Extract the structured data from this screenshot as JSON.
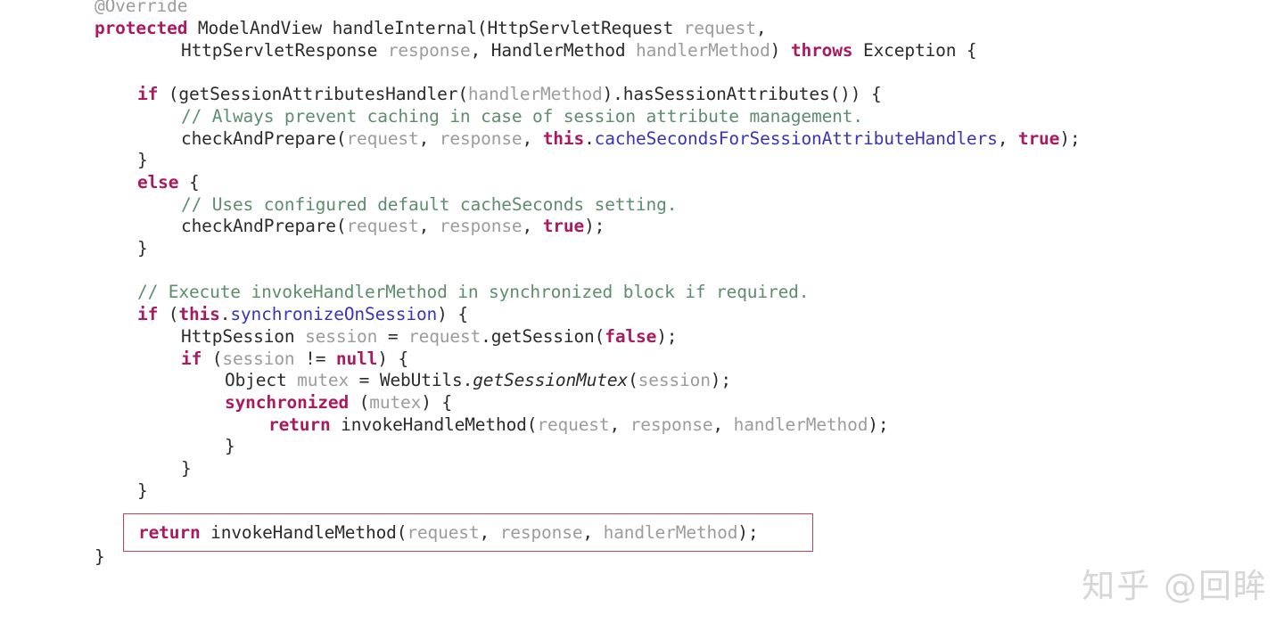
{
  "editor": {
    "language": "java",
    "background_color": "#ffffff",
    "font_size_px": 19.5,
    "line_height_px": 24.7,
    "colors": {
      "keyword": "#a91b60",
      "type": "#2b2b2b",
      "identifier": "#2b2b2b",
      "parameter": "#9c9c9c",
      "field": "#3a35b8",
      "comment": "#5d8d6e",
      "annotation": "#9c9c9c",
      "static_method": "#2b2b2b",
      "highlight_border": "#c0405c",
      "watermark": "#d6d6d6"
    }
  },
  "code": {
    "line_01": {
      "annotation": "@Override"
    },
    "line_02": {
      "kw_protected": "protected",
      "type_modelandview": "ModelAndView",
      "method_handleinternal": "handleInternal",
      "paren_open": "(",
      "type_httpservletrequest": "HttpServletRequest",
      "param_request": "request",
      "comma": ","
    },
    "line_03": {
      "type_httpservletresponse": "HttpServletResponse",
      "param_response": "response",
      "comma": ", ",
      "type_handlermethod": "HandlerMethod",
      "param_handlermethod": "handlerMethod",
      "paren_close": ")",
      "kw_throws": "throws",
      "type_exception": "Exception",
      "brace_open": "{"
    },
    "line_05": {
      "kw_if": "if",
      "open": " (",
      "method_getsessionattributeshandler": "getSessionAttributesHandler",
      "paren_open": "(",
      "param_handlermethod": "handlerMethod",
      "dot": ").",
      "method_hassessionattributes": "hasSessionAttributes",
      "tail": "()) {"
    },
    "line_06": {
      "comment": "// Always prevent caching in case of session attribute management."
    },
    "line_07": {
      "method_checkandprepare": "checkAndPrepare",
      "paren_open": "(",
      "param_request": "request",
      "comma1": ", ",
      "param_response": "response",
      "comma2": ", ",
      "kw_this": "this",
      "dot": ".",
      "field_cacheseconds": "cacheSecondsForSessionAttributeHandlers",
      "comma3": ", ",
      "kw_true": "true",
      "tail": ");"
    },
    "line_08": {
      "brace_close": "}"
    },
    "line_09": {
      "kw_else": "else",
      "brace_open": " {"
    },
    "line_10": {
      "comment": "// Uses configured default cacheSeconds setting."
    },
    "line_11": {
      "method_checkandprepare": "checkAndPrepare",
      "paren_open": "(",
      "param_request": "request",
      "comma1": ", ",
      "param_response": "response",
      "comma2": ", ",
      "kw_true": "true",
      "tail": ");"
    },
    "line_12": {
      "brace_close": "}"
    },
    "line_14": {
      "comment": "// Execute invokeHandlerMethod in synchronized block if required."
    },
    "line_15": {
      "kw_if": "if",
      "open": " (",
      "kw_this": "this",
      "dot": ".",
      "field_synchronizeonsession": "synchronizeOnSession",
      "tail": ") {"
    },
    "line_16": {
      "type_httpsession": "HttpSession",
      "param_session": " session",
      "equals": " = ",
      "param_request": "request",
      "dot": ".",
      "method_getsession": "getSession",
      "paren_open": "(",
      "kw_false": "false",
      "tail": ");"
    },
    "line_17": {
      "kw_if": "if",
      "open": " (",
      "param_session": "session",
      "op": " != ",
      "kw_null": "null",
      "tail": ") {"
    },
    "line_18": {
      "type_object": "Object",
      "param_mutex": " mutex",
      "equals": " = ",
      "type_webutils": "WebUtils",
      "dot": ".",
      "static_getsessionmutex": "getSessionMutex",
      "paren_open": "(",
      "param_session": "session",
      "tail": ");"
    },
    "line_19": {
      "kw_synchronized": "synchronized",
      "open": " (",
      "param_mutex": "mutex",
      "tail": ") {"
    },
    "line_20": {
      "kw_return": "return",
      "space": " ",
      "method_invokehandlemethod": "invokeHandleMethod",
      "paren_open": "(",
      "param_request": "request",
      "comma1": ", ",
      "param_response": "response",
      "comma2": ", ",
      "param_handlermethod": "handlerMethod",
      "tail": ");"
    },
    "line_21": {
      "brace_close": "}"
    },
    "line_22": {
      "brace_close": "}"
    },
    "line_23": {
      "brace_close": "}"
    },
    "line_25_highlighted": {
      "kw_return": "return",
      "space": " ",
      "method_invokehandlemethod": "invokeHandleMethod",
      "paren_open": "(",
      "param_request": "request",
      "comma1": ", ",
      "param_response": "response",
      "comma2": ", ",
      "param_handlermethod": "handlerMethod",
      "tail": ");"
    },
    "line_26": {
      "brace_close": "}"
    }
  },
  "watermark": {
    "text": "知乎 @回眸"
  }
}
